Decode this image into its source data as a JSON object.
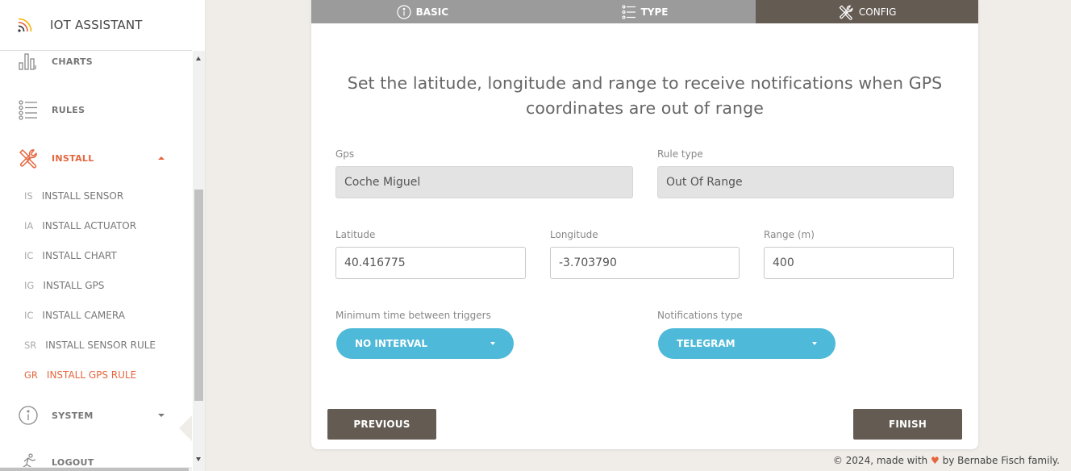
{
  "app": {
    "title": "IOT ASSISTANT"
  },
  "sidebar": {
    "items": [
      {
        "label": "CHARTS"
      },
      {
        "label": "RULES"
      },
      {
        "label": "INSTALL"
      },
      {
        "label": "SYSTEM"
      },
      {
        "label": "LOGOUT"
      }
    ],
    "install_subitems": [
      {
        "abbr": "IS",
        "label": "INSTALL SENSOR"
      },
      {
        "abbr": "IA",
        "label": "INSTALL ACTUATOR"
      },
      {
        "abbr": "IC",
        "label": "INSTALL CHART"
      },
      {
        "abbr": "IG",
        "label": "INSTALL GPS"
      },
      {
        "abbr": "IC",
        "label": "INSTALL CAMERA"
      },
      {
        "abbr": "SR",
        "label": "INSTALL SENSOR RULE"
      },
      {
        "abbr": "GR",
        "label": "INSTALL GPS RULE"
      }
    ]
  },
  "tabs": [
    {
      "label": "BASIC",
      "icon": "info-icon"
    },
    {
      "label": "TYPE",
      "icon": "list-icon"
    },
    {
      "label": "CONFIG",
      "icon": "tools-icon"
    }
  ],
  "form": {
    "heading": "Set the latitude, longitude and range to receive notifications when GPS coordinates are out of range",
    "gps": {
      "label": "Gps",
      "value": "Coche Miguel"
    },
    "rule_type": {
      "label": "Rule type",
      "value": "Out Of Range"
    },
    "latitude": {
      "label": "Latitude",
      "value": "40.416775"
    },
    "longitude": {
      "label": "Longitude",
      "value": "-3.703790"
    },
    "range": {
      "label": "Range (m)",
      "value": "400"
    },
    "min_time": {
      "label": "Minimum time between triggers",
      "value": "NO INTERVAL"
    },
    "notifications": {
      "label": "Notifications type",
      "value": "TELEGRAM"
    }
  },
  "buttons": {
    "previous": "PREVIOUS",
    "finish": "FINISH"
  },
  "footer": {
    "prefix": "© 2024, made with",
    "heart": "♥",
    "suffix": "by Bernabe Fisch family."
  },
  "colors": {
    "accent": "#e5663d",
    "dark_tab": "#645b53",
    "pill": "#4eb9d8",
    "tab_inactive": "#9b9b9b"
  }
}
